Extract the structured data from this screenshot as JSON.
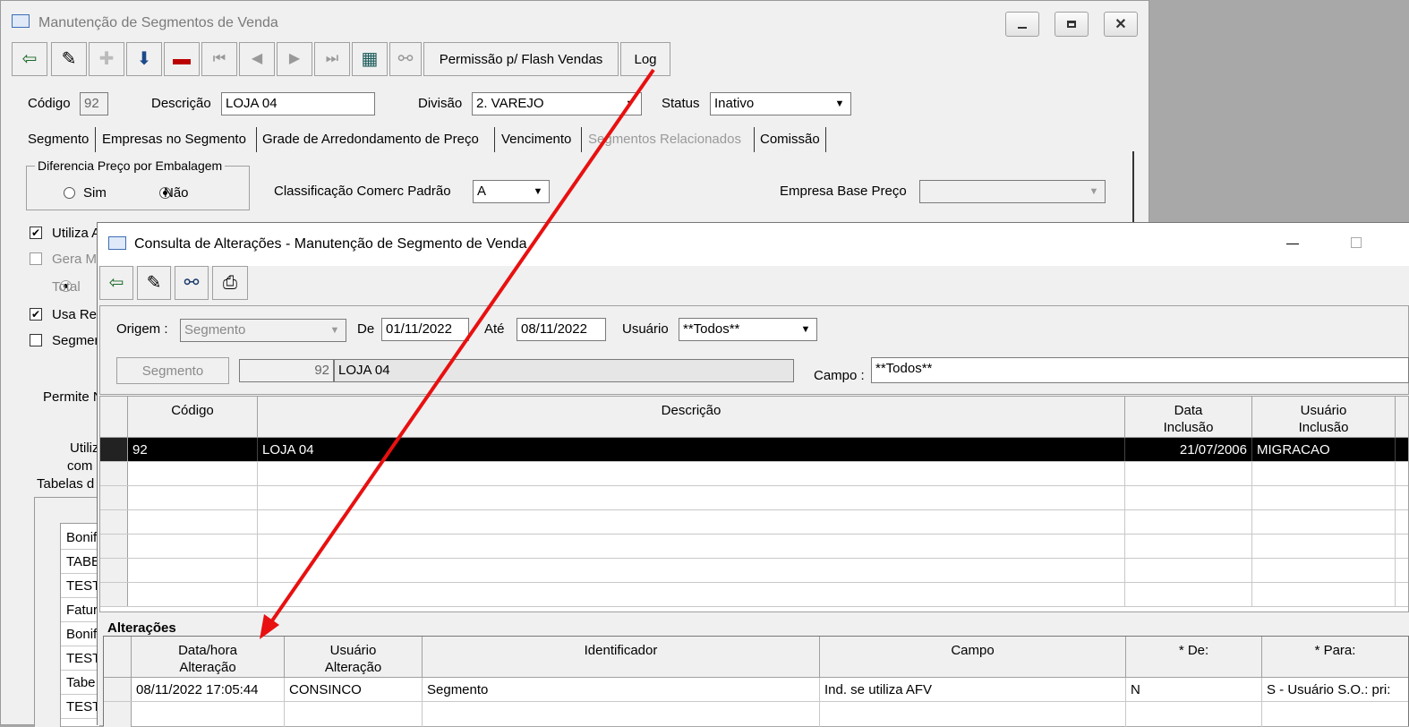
{
  "main_window": {
    "title": "Manutenção de Segmentos de Venda",
    "toolbar": {
      "flash_label": "Permissão p/ Flash Vendas",
      "log_label": "Log"
    },
    "header": {
      "codigo_label": "Código",
      "codigo_value": "92",
      "descricao_label": "Descrição",
      "descricao_value": "LOJA 04",
      "divisao_label": "Divisão",
      "divisao_value": "2. VAREJO",
      "status_label": "Status",
      "status_value": "Inativo"
    },
    "tabs": [
      {
        "label": "Segmento"
      },
      {
        "label": "Empresas no Segmento"
      },
      {
        "label": "Grade de Arredondamento de Preço"
      },
      {
        "label": "Vencimento"
      },
      {
        "label": "Segmentos Relacionados"
      },
      {
        "label": "Comissão"
      }
    ],
    "segment_tab": {
      "group_title": "Diferencia Preço por Embalagem",
      "radio_sim": "Sim",
      "radio_nao": "Não",
      "classificacao_label": "Classificação Comerc Padrão",
      "classificacao_value": "A",
      "empresa_base_label": "Empresa Base Preço",
      "empresa_base_value": "",
      "utiliza_label": "Utiliza A",
      "gera_label": "Gera M",
      "total_label": "Total",
      "usa_label": "Usa Re",
      "segmen_label": "Segmen",
      "permite_label": "Permite N",
      "utiliz_label": "Utiliz",
      "com_label": "com",
      "tabelas_label": "Tabelas d",
      "list_items": [
        "Bonif",
        "TABE",
        "TEST",
        "Fatur",
        "Bonif",
        "TEST",
        "Tabe",
        "TEST"
      ]
    }
  },
  "dialog": {
    "title": "Consulta de Alterações - Manutenção de Segmento de Venda",
    "filters": {
      "origem_label": "Origem :",
      "origem_value": "Segmento",
      "de_label": "De",
      "de_value": "01/11/2022",
      "ate_label": "Até",
      "ate_value": "08/11/2022",
      "usuario_label": "Usuário",
      "usuario_value": "**Todos**",
      "segmento_button": "Segmento",
      "seg_code": "92",
      "seg_desc": "LOJA 04",
      "campo_label": "Campo :",
      "campo_value": "**Todos**"
    },
    "grid1": {
      "columns": [
        "Código",
        "Descrição",
        "Data\nInclusão",
        "Usuário\nInclusão"
      ],
      "rows": [
        {
          "codigo": "92",
          "descricao": "LOJA 04",
          "data": "21/07/2006",
          "usuario": "MIGRACAO"
        }
      ]
    },
    "alteracoes": {
      "title": "Alterações",
      "columns": [
        "Data/hora\nAlteração",
        "Usuário\nAlteração",
        "Identificador",
        "Campo",
        "* De:",
        "* Para:"
      ],
      "rows": [
        {
          "data": "08/11/2022 17:05:44",
          "usuario": "CONSINCO",
          "identificador": "Segmento",
          "campo": "Ind. se utiliza AFV",
          "de": "N",
          "para": "S - Usuário S.O.: pri:"
        }
      ]
    }
  },
  "colors": {
    "arrow": "#e81010",
    "selected_row": "#000000"
  }
}
